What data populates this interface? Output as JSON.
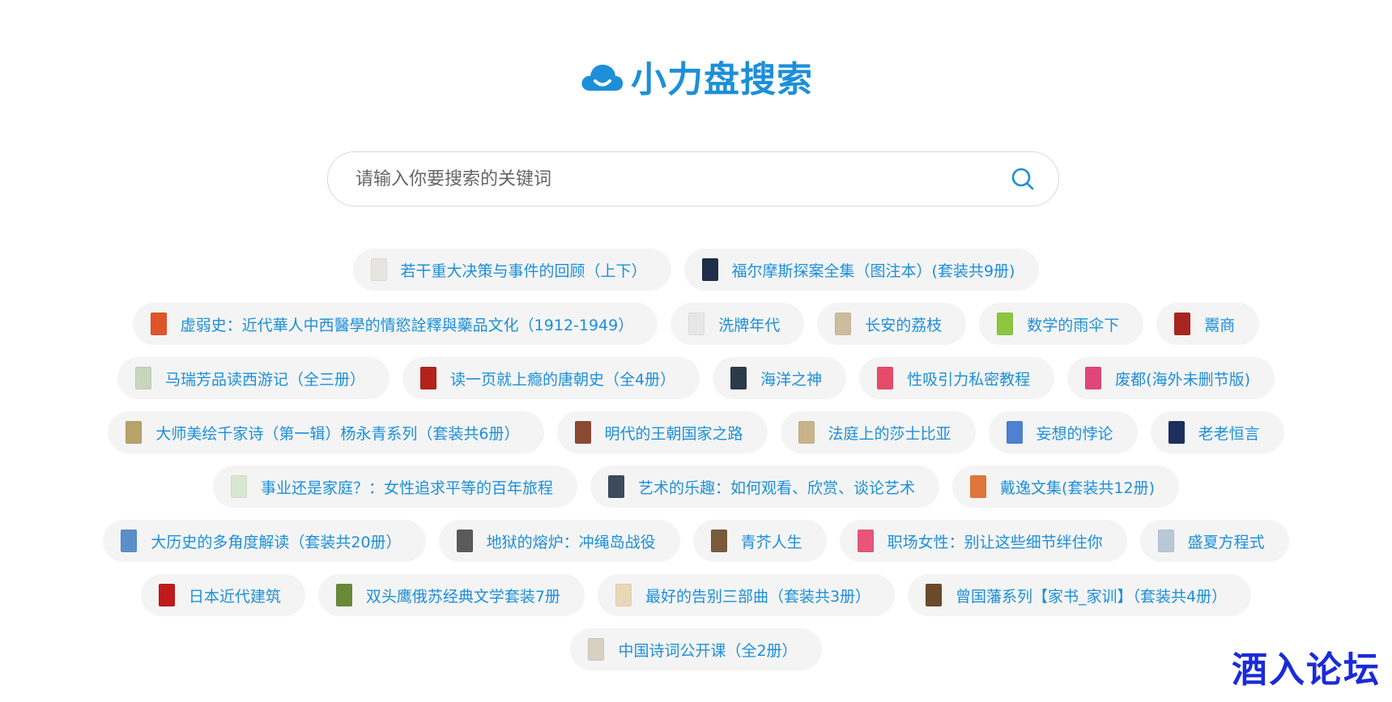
{
  "header": {
    "logo_text": "小力盘搜索",
    "accent_color": "#1d8fd9"
  },
  "search": {
    "placeholder": "请输入你要搜索的关键词",
    "value": "",
    "icon": "search-icon"
  },
  "tag_rows": [
    [
      {
        "label": "若干重大决策与事件的回顾（上下）",
        "thumb": "#e8e4e0"
      },
      {
        "label": "福尔摩斯探案全集（图注本）(套装共9册)",
        "thumb": "#1f2f48"
      }
    ],
    [
      {
        "label": "虚弱史：近代華人中西醫學的情慾詮釋與藥品文化（1912-1949）",
        "thumb": "#e0542a"
      },
      {
        "label": "洗牌年代",
        "thumb": "#e6e6e6"
      },
      {
        "label": "长安的荔枝",
        "thumb": "#cdbd9f"
      },
      {
        "label": "数学的雨伞下",
        "thumb": "#8cc63f"
      },
      {
        "label": "鬻商",
        "thumb": "#a8261f"
      }
    ],
    [
      {
        "label": "马瑞芳品读西游记（全三册）",
        "thumb": "#c8d6c0"
      },
      {
        "label": "读一页就上瘾的唐朝史（全4册）",
        "thumb": "#b3221c"
      },
      {
        "label": "海洋之神",
        "thumb": "#2c3a4a"
      },
      {
        "label": "性吸引力私密教程",
        "thumb": "#e84b6a"
      },
      {
        "label": "废都(海外未删节版)",
        "thumb": "#e0467a"
      }
    ],
    [
      {
        "label": "大师美绘千家诗（第一辑）杨永青系列（套装共6册）",
        "thumb": "#b7a36a"
      },
      {
        "label": "明代的王朝国家之路",
        "thumb": "#8a4a32"
      },
      {
        "label": "法庭上的莎士比亚",
        "thumb": "#c9b48a"
      },
      {
        "label": "妄想的悖论",
        "thumb": "#4f7fd0"
      },
      {
        "label": "老老恒言",
        "thumb": "#1c2f5f"
      }
    ],
    [
      {
        "label": "事业还是家庭？：女性追求平等的百年旅程",
        "thumb": "#d8e8d0"
      },
      {
        "label": "艺术的乐趣：如何观看、欣赏、谈论艺术",
        "thumb": "#3c4a5c"
      },
      {
        "label": "戴逸文集(套装共12册)",
        "thumb": "#e0763a"
      }
    ],
    [
      {
        "label": "大历史的多角度解读（套装共20册）",
        "thumb": "#5a8fc8"
      },
      {
        "label": "地狱的熔炉：冲绳岛战役",
        "thumb": "#5a5a5a"
      },
      {
        "label": "青芥人生",
        "thumb": "#7a5a3a"
      },
      {
        "label": "职场女性：别让这些细节绊住你",
        "thumb": "#e8557a"
      },
      {
        "label": "盛夏方程式",
        "thumb": "#b8c8d8"
      }
    ],
    [
      {
        "label": "日本近代建筑",
        "thumb": "#c01a1a"
      },
      {
        "label": "双头鹰俄苏经典文学套装7册",
        "thumb": "#6a8a3a"
      },
      {
        "label": "最好的告别三部曲（套装共3册）",
        "thumb": "#e8d8b8"
      },
      {
        "label": "曾国藩系列【家书_家训】（套装共4册）",
        "thumb": "#6a4a2a"
      }
    ],
    [
      {
        "label": "中国诗词公开课（全2册）",
        "thumb": "#d8d0c0"
      }
    ]
  ],
  "watermark": {
    "text": "酒入论坛",
    "color": "#1a2bd8"
  }
}
